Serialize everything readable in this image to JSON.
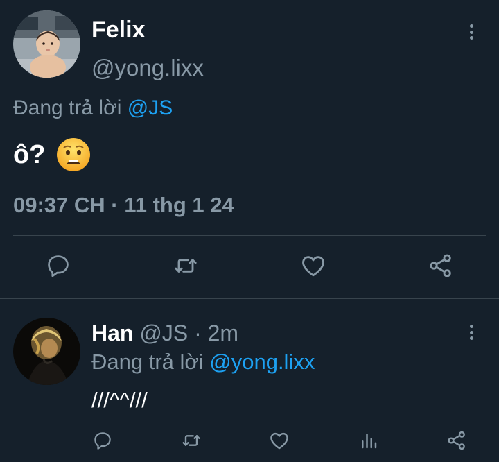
{
  "main_tweet": {
    "display_name": "Felix",
    "handle": "@yong.lixx",
    "reply_prefix": "Đang trả lời",
    "reply_to": "@JS",
    "text": "ô?",
    "emoji": "😦",
    "timestamp": "09:37 CH · 11 thg 1 24",
    "actions": [
      "reply-icon",
      "retweet-icon",
      "like-icon",
      "share-icon"
    ]
  },
  "reply_tweet": {
    "display_name": "Han",
    "handle": "@JS",
    "separator": "·",
    "time_ago": "2m",
    "reply_prefix": "Đang trả lời",
    "reply_to": "@yong.lixx",
    "text": "///^^///",
    "actions": [
      "reply-icon",
      "retweet-icon",
      "like-icon",
      "analytics-icon",
      "share-icon"
    ]
  },
  "colors": {
    "background": "#15202b",
    "text": "#ffffff",
    "muted": "#8899a6",
    "link": "#1da1f2",
    "divider": "#38444d"
  }
}
